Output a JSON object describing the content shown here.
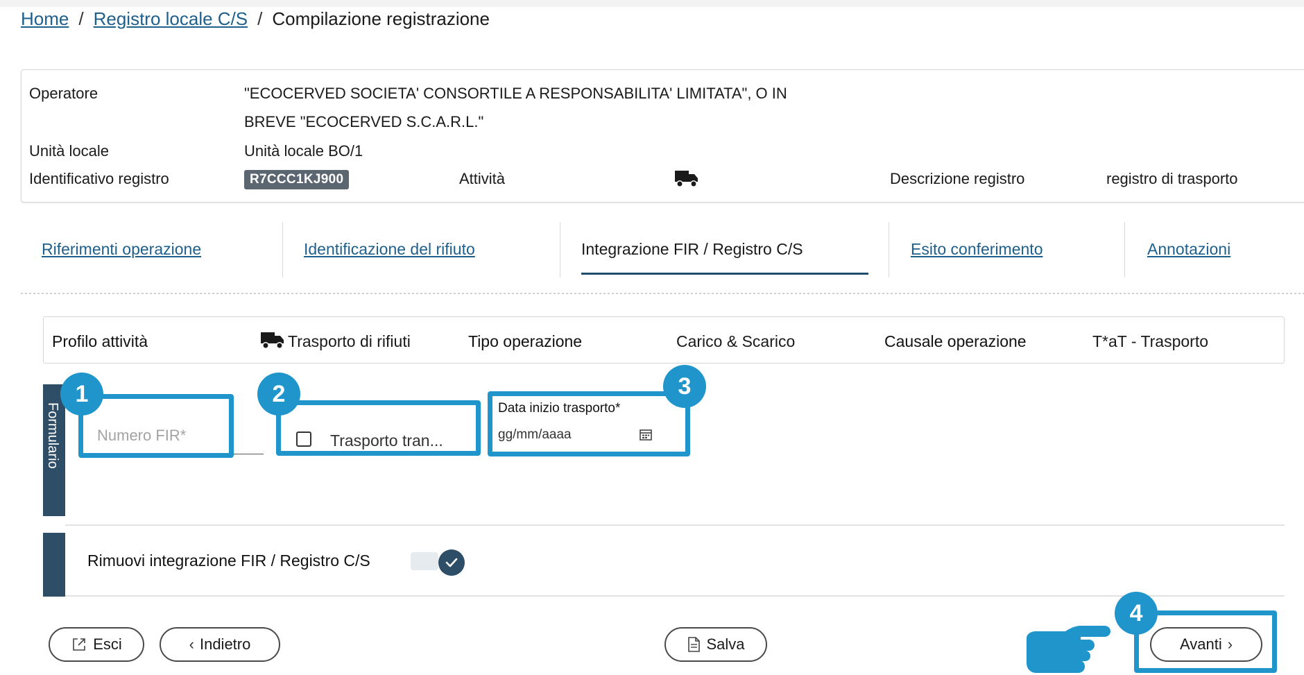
{
  "breadcrumb": {
    "home": "Home",
    "sep1": "/",
    "registro": "Registro locale C/S",
    "sep2": "/",
    "current": "Compilazione registrazione"
  },
  "info": {
    "operatore_label": "Operatore",
    "operatore_value_line1": "\"ECOCERVED SOCIETA' CONSORTILE A RESPONSABILITA' LIMITATA\", O IN",
    "operatore_value_line2": "BREVE \"ECOCERVED S.C.A.R.L.\"",
    "unita_label": "Unità locale",
    "unita_value": "Unità locale BO/1",
    "identificativo_label": "Identificativo registro",
    "identificativo_value": "R7CCC1KJ900",
    "attivita_label": "Attività",
    "attivita_icon": "truck-icon",
    "descrizione_label": "Descrizione registro",
    "descrizione_value": "registro di trasporto"
  },
  "tabs": [
    {
      "label": "Riferimenti operazione",
      "active": false
    },
    {
      "label": "Identificazione del rifiuto",
      "active": false
    },
    {
      "label": "Integrazione FIR / Registro C/S",
      "active": true
    },
    {
      "label": "Esito conferimento",
      "active": false
    },
    {
      "label": "Annotazioni",
      "active": false
    }
  ],
  "profile": {
    "profilo_label": "Profilo attività",
    "profilo_value": "Trasporto di rifiuti",
    "tipo_label": "Tipo operazione",
    "tipo_value": "Carico & Scarico",
    "causale_label": "Causale operazione",
    "causale_value": "T*aT - Trasporto"
  },
  "form": {
    "side_label": "Formulario",
    "numero_fir_placeholder": "Numero FIR*",
    "trasporto_checkbox_label": "Trasporto tran...",
    "data_label": "Data inizio trasporto*",
    "data_placeholder": "gg/mm/aaaa"
  },
  "remove": {
    "label": "Rimuovi integrazione FIR / Registro C/S"
  },
  "buttons": {
    "esci": "Esci",
    "indietro": "Indietro",
    "salva": "Salva",
    "avanti": "Avanti"
  },
  "callouts": [
    "1",
    "2",
    "3",
    "4"
  ],
  "colors": {
    "accent": "#1f95cc",
    "link": "#1f5f8b",
    "dark_panel": "#2e4d66",
    "badge": "#5b6670"
  }
}
